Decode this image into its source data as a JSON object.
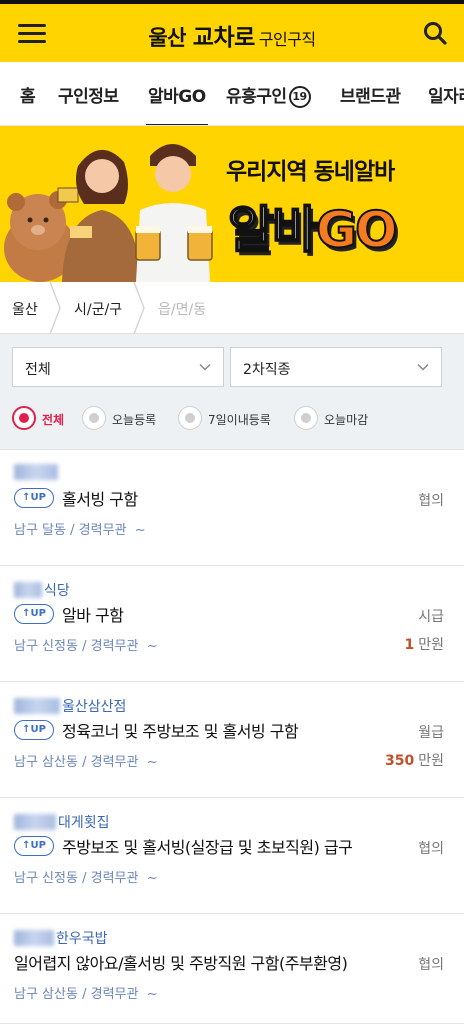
{
  "header": {
    "logo_left": "울산",
    "logo_bold": "교차로",
    "logo_sub": "구인구직"
  },
  "tabs": [
    {
      "label": "홈"
    },
    {
      "label": "구인정보"
    },
    {
      "label": "알바GO"
    },
    {
      "label": "유흥구인"
    },
    {
      "label": "브랜드관"
    },
    {
      "label": "일자리"
    }
  ],
  "tab_badge": "19",
  "banner": {
    "line1": "우리지역 동네알바",
    "line2a": "알바",
    "line2b": "GO"
  },
  "location": {
    "level1": "울산",
    "level2": "시/군/구",
    "level3": "읍/면/동"
  },
  "filters": {
    "category": "전체",
    "subcategory": "2차직종",
    "radios": [
      {
        "label": "전체",
        "selected": true
      },
      {
        "label": "오늘등록",
        "selected": false
      },
      {
        "label": "7일이내등록",
        "selected": false
      },
      {
        "label": "오늘마감",
        "selected": false
      }
    ]
  },
  "up_label": "UP",
  "jobs": [
    {
      "company": "",
      "up": true,
      "title": "홀서빙 구함",
      "location": "남구 달동",
      "career": "경력무관",
      "pay_type": "협의",
      "pay_amount": "",
      "pay_unit": ""
    },
    {
      "company": "식당",
      "up": true,
      "title": "알바 구함",
      "location": "남구 신정동",
      "career": "경력무관",
      "pay_type": "시급",
      "pay_amount": "1",
      "pay_unit": "만원"
    },
    {
      "company": "울산삼산점",
      "up": true,
      "title": "정육코너 및 주방보조 및 홀서빙 구함",
      "location": "남구 삼산동",
      "career": "경력무관",
      "pay_type": "월급",
      "pay_amount": "350",
      "pay_unit": "만원"
    },
    {
      "company": "대게횟집",
      "up": true,
      "title": "주방보조 및 홀서빙(실장급 및 초보직원) 급구",
      "location": "남구 신정동",
      "career": "경력무관",
      "pay_type": "협의",
      "pay_amount": "",
      "pay_unit": ""
    },
    {
      "company": "한우국밥",
      "up": false,
      "title": "일어렵지 않아요/홀서빙 및 주방직원 구함(주부환영)",
      "location": "남구 삼산동",
      "career": "경력무관",
      "pay_type": "협의",
      "pay_amount": "",
      "pay_unit": ""
    }
  ],
  "meta_separator": "/",
  "meta_more": "~",
  "colors": {
    "brand_yellow": "#ffd400",
    "accent_red": "#e0204a",
    "link_blue": "#3a67b8",
    "pay_orange": "#c0502a"
  }
}
